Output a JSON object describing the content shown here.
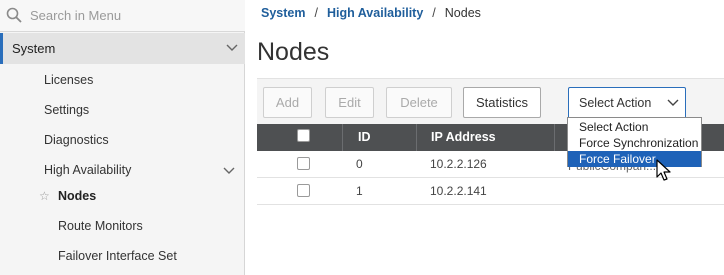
{
  "sidebar": {
    "search_placeholder": "Search in Menu",
    "section_label": "System",
    "items": [
      {
        "label": "Licenses"
      },
      {
        "label": "Settings"
      },
      {
        "label": "Diagnostics"
      },
      {
        "label": "High Availability"
      },
      {
        "label": "Nodes"
      },
      {
        "label": "Route Monitors"
      },
      {
        "label": "Failover Interface Set"
      }
    ]
  },
  "breadcrumb": {
    "items": [
      "System",
      "High Availability"
    ],
    "separator": "/",
    "current": "Nodes"
  },
  "page": {
    "title": "Nodes"
  },
  "toolbar": {
    "add": "Add",
    "edit": "Edit",
    "delete": "Delete",
    "statistics": "Statistics",
    "select_action": "Select Action"
  },
  "table": {
    "columns": [
      "ID",
      "IP Address"
    ],
    "rows": [
      {
        "id": "0",
        "ip": "10.2.2.126",
        "extra": "PublicCompan..."
      },
      {
        "id": "1",
        "ip": "10.2.2.141",
        "extra": ""
      }
    ]
  },
  "dropdown": {
    "options": [
      "Select Action",
      "Force Synchronization",
      "Force Failover"
    ],
    "highlighted": "Force Failover"
  },
  "colors": {
    "accent": "#2a6ebb",
    "link": "#1f5e9b",
    "table_header": "#4e5052",
    "option_highlight": "#1e62b8"
  }
}
